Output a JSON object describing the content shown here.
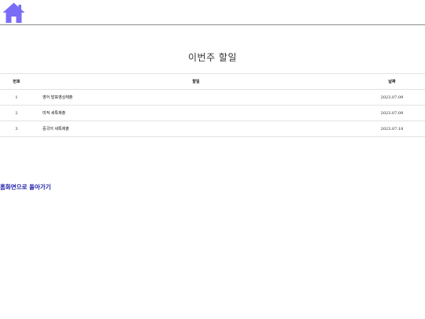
{
  "header": {
    "home_icon": "home-icon",
    "icon_color": "#7b6cf6"
  },
  "page": {
    "title": "이번주 할일"
  },
  "table": {
    "columns": [
      "번호",
      "할일",
      "날짜"
    ],
    "rows": [
      {
        "no": "1",
        "task": "영어 발표영상제출",
        "date": "2023.07.09"
      },
      {
        "no": "2",
        "task": "미적 세특제출",
        "date": "2023.07.09"
      },
      {
        "no": "3",
        "task": "중국어 세특제출",
        "date": "2023.07.18"
      }
    ]
  },
  "footer": {
    "back_link": "홈화면으로 돌아가기",
    "link_color": "#1a1aa8"
  }
}
